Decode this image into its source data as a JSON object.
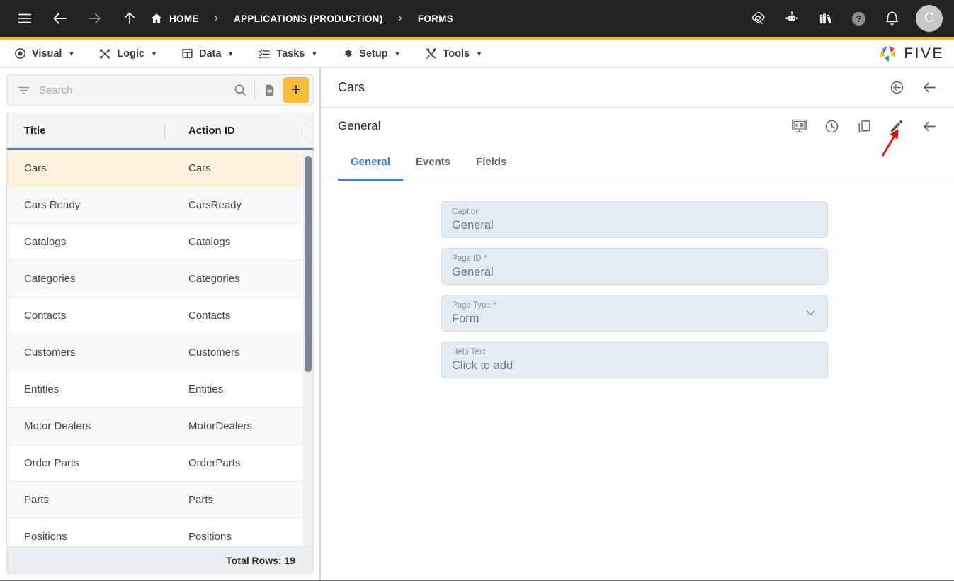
{
  "topbar": {
    "menu_icon": "hamburger-icon",
    "back_icon": "arrow-left-icon",
    "forward_icon": "arrow-right-icon",
    "up_icon": "arrow-up-icon",
    "breadcrumbs": [
      {
        "label": "HOME",
        "icon": "home-icon"
      },
      {
        "label": "APPLICATIONS (PRODUCTION)",
        "icon": ""
      },
      {
        "label": "FORMS",
        "icon": ""
      }
    ],
    "separator": "›",
    "actions": [
      {
        "name": "cloud-check-search-icon",
        "title": "Deploy"
      },
      {
        "name": "robot-chat-icon",
        "title": "Assistant"
      },
      {
        "name": "books-icon",
        "title": "Documentation"
      },
      {
        "name": "help-circle-icon",
        "title": "Help"
      },
      {
        "name": "bell-icon",
        "title": "Notifications"
      }
    ],
    "avatar_initial": "C",
    "accent_color": "#f7bc31",
    "background_color": "#232323"
  },
  "menubar": {
    "items": [
      {
        "label": "Visual",
        "icon": "eye-icon",
        "caret": "▼"
      },
      {
        "label": "Logic",
        "icon": "nodes-icon",
        "caret": "▼"
      },
      {
        "label": "Data",
        "icon": "table-icon",
        "caret": "▼"
      },
      {
        "label": "Tasks",
        "icon": "checklist-icon",
        "caret": "▼"
      },
      {
        "label": "Setup",
        "icon": "gear-icon",
        "caret": "▼"
      },
      {
        "label": "Tools",
        "icon": "tools-icon",
        "caret": "▼"
      }
    ],
    "brand": {
      "text": "FIVE",
      "icon": "five-pinwheel-logo"
    }
  },
  "sidebar": {
    "search": {
      "placeholder": "Search",
      "value": ""
    },
    "filter_icon": "filter-icon",
    "search_icon": "search-icon",
    "document_icon": "document-icon",
    "add_label": "+",
    "columns": [
      "Title",
      "Action ID"
    ],
    "rows": [
      {
        "title": "Cars",
        "action_id": "Cars",
        "selected": true
      },
      {
        "title": "Cars Ready",
        "action_id": "CarsReady",
        "selected": false
      },
      {
        "title": "Catalogs",
        "action_id": "Catalogs",
        "selected": false
      },
      {
        "title": "Categories",
        "action_id": "Categories",
        "selected": false
      },
      {
        "title": "Contacts",
        "action_id": "Contacts",
        "selected": false
      },
      {
        "title": "Customers",
        "action_id": "Customers",
        "selected": false
      },
      {
        "title": "Entities",
        "action_id": "Entities",
        "selected": false
      },
      {
        "title": "Motor Dealers",
        "action_id": "MotorDealers",
        "selected": false
      },
      {
        "title": "Order Parts",
        "action_id": "OrderParts",
        "selected": false
      },
      {
        "title": "Parts",
        "action_id": "Parts",
        "selected": false
      },
      {
        "title": "Positions",
        "action_id": "Positions",
        "selected": false
      }
    ],
    "footer": "Total Rows: 19"
  },
  "panel": {
    "title": "Cars",
    "header_actions": [
      {
        "name": "back-circle-icon"
      },
      {
        "name": "arrow-left-icon"
      }
    ],
    "sub_title": "General",
    "sub_actions": [
      {
        "name": "form-preview-icon"
      },
      {
        "name": "history-clock-icon"
      },
      {
        "name": "duplicate-icon"
      },
      {
        "name": "edit-pencil-icon"
      },
      {
        "name": "arrow-left-icon"
      }
    ],
    "tabs": [
      {
        "label": "General",
        "active": true
      },
      {
        "label": "Events",
        "active": false
      },
      {
        "label": "Fields",
        "active": false
      }
    ],
    "fields": [
      {
        "label": "Caption",
        "value": "General",
        "type": "text"
      },
      {
        "label": "Page ID *",
        "value": "General",
        "type": "text"
      },
      {
        "label": "Page Type *",
        "value": "Form",
        "type": "select"
      },
      {
        "label": "Help Text",
        "value": "Click to add",
        "type": "text"
      }
    ]
  },
  "annotation": {
    "type": "arrow",
    "color": "#f80000",
    "points_to": "edit-pencil-icon"
  }
}
